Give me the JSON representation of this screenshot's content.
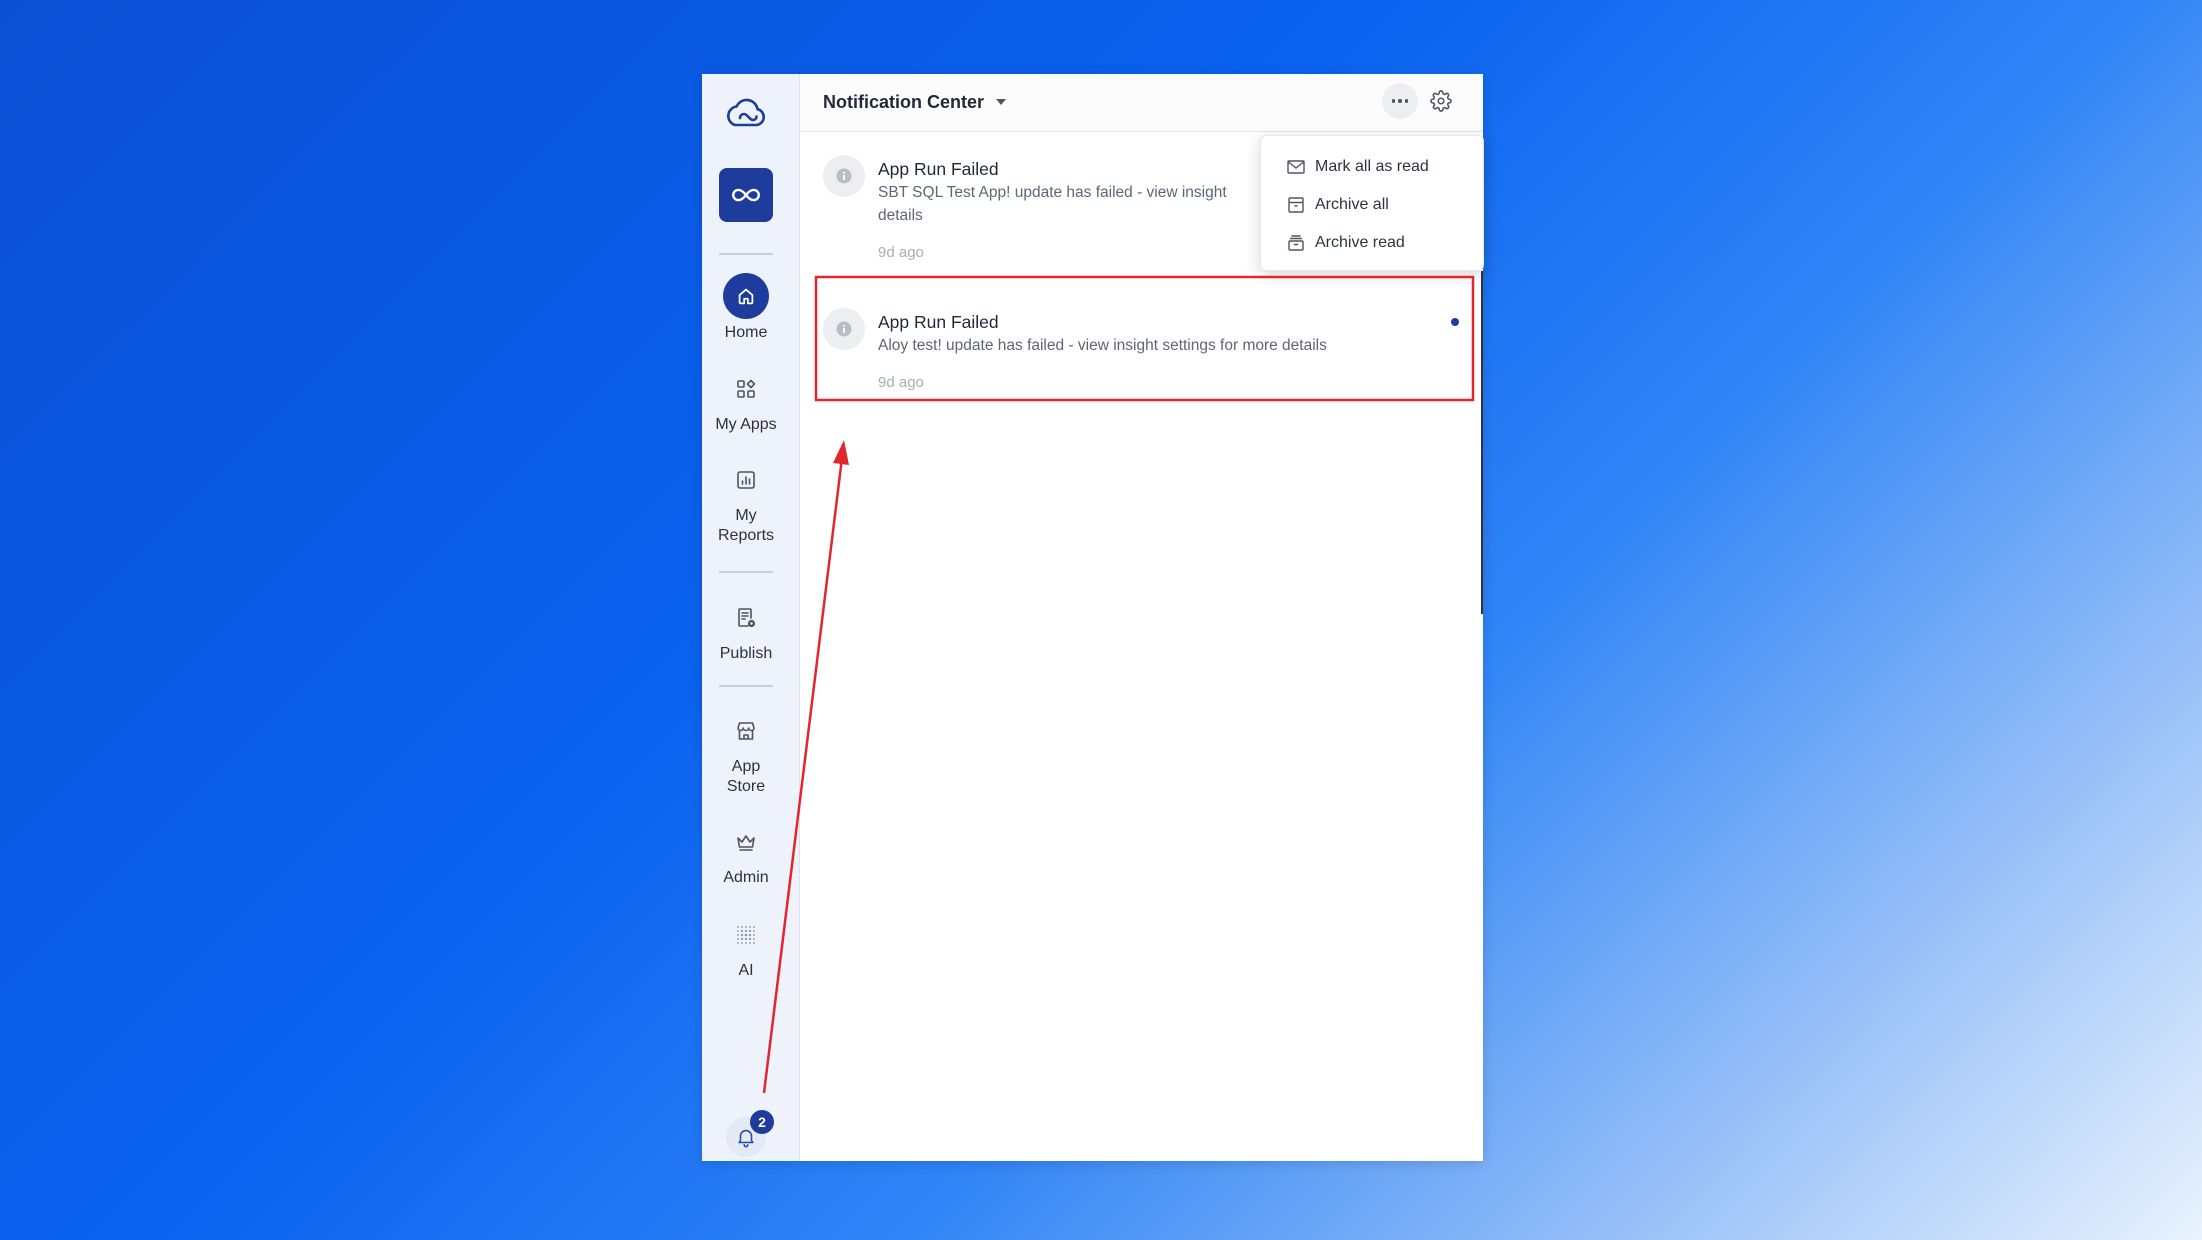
{
  "colors": {
    "primary": "#1d3c9b",
    "sidebar_bg": "#eef2fb",
    "annotation_red": "#e3262e"
  },
  "sidebar": {
    "logo_icon": "cloud-logo-icon",
    "app_tile_icon": "infinity-icon",
    "nav": [
      {
        "label": "Home",
        "icon": "home-icon",
        "active": true
      },
      {
        "label": "My Apps",
        "icon": "apps-grid-icon",
        "active": false
      },
      {
        "label": "My Reports",
        "icon": "reports-chart-icon",
        "active": false
      },
      {
        "label": "Publish",
        "icon": "publish-document-icon",
        "active": false
      },
      {
        "label": "App Store",
        "icon": "storefront-icon",
        "active": false
      },
      {
        "label": "Admin",
        "icon": "crown-icon",
        "active": false
      },
      {
        "label": "AI",
        "icon": "ai-dots-icon",
        "active": false
      }
    ],
    "notifications_button": {
      "icon": "bell-icon",
      "badge_count": 2
    }
  },
  "header": {
    "title": "Notification Center",
    "title_icon": "caret-down-icon",
    "more_icon": "ellipsis-icon",
    "settings_icon": "gear-icon"
  },
  "more_menu": {
    "open": true,
    "items": [
      {
        "label": "Mark all as read",
        "icon": "envelope-icon"
      },
      {
        "label": "Archive all",
        "icon": "archive-box-icon"
      },
      {
        "label": "Archive read",
        "icon": "archive-tray-icon"
      }
    ]
  },
  "notifications": [
    {
      "icon": "info-icon",
      "title": "App Run Failed",
      "body_lines": [
        "SBT SQL Test App! update has failed - view insight",
        "details"
      ],
      "time": "9d ago",
      "unread": false
    },
    {
      "icon": "info-icon",
      "title": "App Run Failed",
      "body_lines": [
        "Aloy test! update has failed - view insight settings for more details"
      ],
      "time": "9d ago",
      "unread": true
    }
  ]
}
